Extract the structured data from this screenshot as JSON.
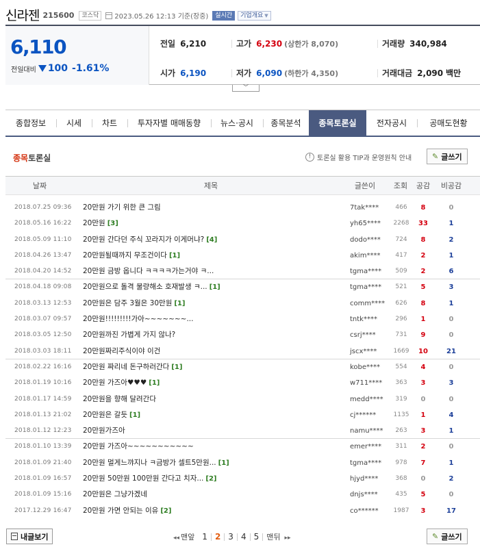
{
  "stock": {
    "name": "신라젠",
    "code": "215600",
    "market": "코스닥",
    "datetime": "2023.05.26 12:13",
    "basis": "기준(장중)",
    "realtime_label": "실시간",
    "company_overview_label": "기업개요",
    "price": "6,110",
    "change_label": "전일대비",
    "change_value": "100",
    "change_rate": "-1.61%",
    "prev_close_label": "전일",
    "prev_close": "6,210",
    "high_label": "고가",
    "high": "6,230",
    "upper_limit_text": "(상한가 8,070)",
    "volume_label": "거래량",
    "volume": "340,984",
    "open_label": "시가",
    "open": "6,190",
    "low_label": "저가",
    "low": "6,090",
    "lower_limit_text": "(하한가 4,350)",
    "amount_label": "거래대금",
    "amount": "2,090",
    "amount_unit": "백만"
  },
  "tabs": [
    {
      "label": "종합정보"
    },
    {
      "label": "시세"
    },
    {
      "label": "차트"
    },
    {
      "label": "투자자별 매매동향"
    },
    {
      "label": "뉴스·공시"
    },
    {
      "label": "종목분석"
    },
    {
      "label": "종목토론실",
      "active": true
    },
    {
      "label": "전자공시"
    },
    {
      "label": "공매도현황"
    }
  ],
  "board": {
    "title_red": "종목",
    "title_rest": "토론실",
    "tip_text": "토론실 활용 TIP과 운영원칙 안내",
    "write_label": "글쓰기",
    "my_posts_label": "내글보기"
  },
  "columns": {
    "date": "날짜",
    "title": "제목",
    "author": "글쓴이",
    "views": "조회",
    "up": "공감",
    "down": "비공감"
  },
  "posts": [
    {
      "date": "2018.07.25 09:36",
      "title": "20만원 가기 위한 큰 그림",
      "comments": "",
      "author": "7tak****",
      "views": "466",
      "up": "8",
      "down": "0"
    },
    {
      "date": "2018.05.16 16:22",
      "title": "20만원",
      "comments": "[3]",
      "author": "yh65****",
      "views": "2268",
      "up": "33",
      "down": "1"
    },
    {
      "date": "2018.05.09 11:10",
      "title": "20만원 간다던 주식 꼬라지가 이게머냐?",
      "comments": "[4]",
      "author": "dodo****",
      "views": "724",
      "up": "8",
      "down": "2"
    },
    {
      "date": "2018.04.26 13:47",
      "title": "20만원될때까지 무조건이다",
      "comments": "[1]",
      "author": "akim****",
      "views": "417",
      "up": "2",
      "down": "1"
    },
    {
      "date": "2018.04.20 14:52",
      "title": "20만원 금방 옵니다 ㅋㅋㅋㅋ가는거야 ㅋ...",
      "comments": "",
      "author": "tgma****",
      "views": "509",
      "up": "2",
      "down": "6"
    },
    {
      "date": "2018.04.18 09:08",
      "title": "20만원으로 돌격 물량해소 호재발생 ㅋ...",
      "comments": "[1]",
      "author": "tgma****",
      "views": "521",
      "up": "5",
      "down": "3"
    },
    {
      "date": "2018.03.13 12:53",
      "title": "20만원은 담주 3월은 30만원",
      "comments": "[1]",
      "author": "comm****",
      "views": "626",
      "up": "8",
      "down": "1"
    },
    {
      "date": "2018.03.07 09:57",
      "title": "20만원!!!!!!!!!가아~~~~~~~...",
      "comments": "",
      "author": "tntk****",
      "views": "296",
      "up": "1",
      "down": "0"
    },
    {
      "date": "2018.03.05 12:50",
      "title": "20만원까진 가볍게 가지 않나?",
      "comments": "",
      "author": "csrj****",
      "views": "731",
      "up": "9",
      "down": "0"
    },
    {
      "date": "2018.03.03 18:11",
      "title": "20만원짜리주식이야 이건",
      "comments": "",
      "author": "jscx****",
      "views": "1669",
      "up": "10",
      "down": "21"
    },
    {
      "date": "2018.02.22 16:16",
      "title": "20만원 짜리네 돈구하러간다",
      "comments": "[1]",
      "author": "kobe****",
      "views": "554",
      "up": "4",
      "down": "0"
    },
    {
      "date": "2018.01.19 10:16",
      "title": "20만원 가즈아♥♥♥",
      "comments": "[1]",
      "author": "w711****",
      "views": "363",
      "up": "3",
      "down": "3"
    },
    {
      "date": "2018.01.17 14:59",
      "title": "20만원을 향해 달려간다",
      "comments": "",
      "author": "medd****",
      "views": "319",
      "up": "0",
      "down": "0"
    },
    {
      "date": "2018.01.13 21:02",
      "title": "20만원은 갈듯",
      "comments": "[1]",
      "author": "cj******",
      "views": "1135",
      "up": "1",
      "down": "4"
    },
    {
      "date": "2018.01.12 12:23",
      "title": "20만원가즈아",
      "comments": "",
      "author": "namu****",
      "views": "263",
      "up": "3",
      "down": "1"
    },
    {
      "date": "2018.01.10 13:39",
      "title": "20만원 가즈아~~~~~~~~~~~",
      "comments": "",
      "author": "emer****",
      "views": "311",
      "up": "2",
      "down": "0"
    },
    {
      "date": "2018.01.09 21:40",
      "title": "20만원 멀게느꺄지나 ㅋ금방가 셀트5만원...",
      "comments": "[1]",
      "author": "tgma****",
      "views": "978",
      "up": "7",
      "down": "1"
    },
    {
      "date": "2018.01.09 16:57",
      "title": "20만원 50만원 100만원 간다고 치자...",
      "comments": "[2]",
      "author": "hjyd****",
      "views": "368",
      "up": "0",
      "down": "2"
    },
    {
      "date": "2018.01.09 15:16",
      "title": "20만원은 그냥가겠네",
      "comments": "",
      "author": "dnjs****",
      "views": "435",
      "up": "5",
      "down": "0"
    },
    {
      "date": "2017.12.29 16:47",
      "title": "20만원 가면 안되는 이유",
      "comments": "[2]",
      "author": "co******",
      "views": "1987",
      "up": "3",
      "down": "17"
    }
  ],
  "pagination": {
    "first_label": "맨앞",
    "pages": [
      "1",
      "2",
      "3",
      "4",
      "5"
    ],
    "current": "2",
    "last_label": "맨뒤"
  }
}
